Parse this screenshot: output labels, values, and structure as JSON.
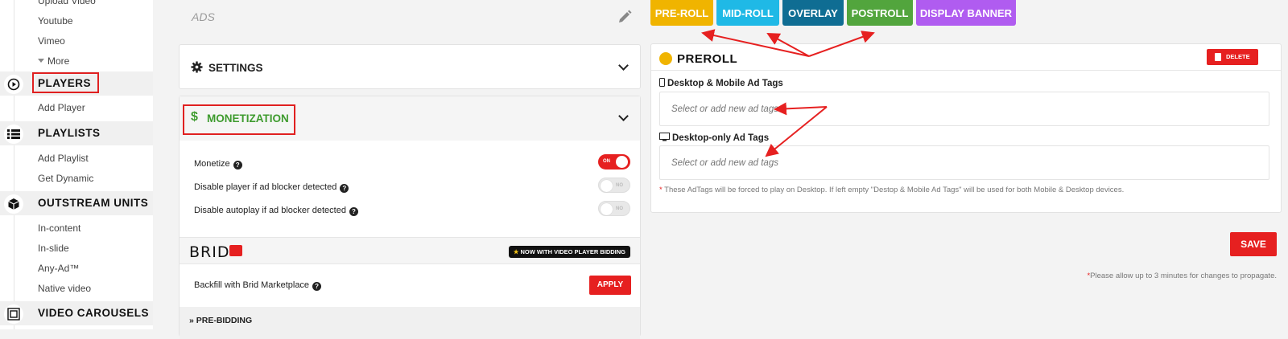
{
  "sidebar": {
    "videos_subitems": [
      "Upload Video",
      "Youtube",
      "Vimeo"
    ],
    "more_label": "More",
    "players": {
      "label": "PLAYERS",
      "subitems": [
        "Add Player"
      ]
    },
    "playlists": {
      "label": "PLAYLISTS",
      "subitems": [
        "Add Playlist",
        "Get Dynamic"
      ]
    },
    "outstream": {
      "label": "OUTSTREAM UNITS",
      "subitems": [
        "In-content",
        "In-slide",
        "Any-Ad™",
        "Native video"
      ]
    },
    "carousels": {
      "label": "VIDEO CAROUSELS"
    }
  },
  "ads": {
    "title": "ADS"
  },
  "settings": {
    "title": "SETTINGS"
  },
  "monetization": {
    "title": "MONETIZATION",
    "options": [
      {
        "label": "Monetize",
        "toggle": "ON",
        "state": true
      },
      {
        "label": "Disable player if ad blocker detected",
        "toggle": "NO",
        "state": false
      },
      {
        "label": "Disable autoplay if ad blocker detected",
        "toggle": "NO",
        "state": false
      }
    ],
    "brid_logo": "BRID",
    "bidding_badge": "NOW WITH VIDEO PLAYER BIDDING",
    "backfill_label": "Backfill with Brid Marketplace",
    "apply_label": "APPLY",
    "prebidding_label": "PRE-BIDDING"
  },
  "tabs": [
    {
      "label": "PRE-ROLL",
      "color": "#f0b400"
    },
    {
      "label": "MID-ROLL",
      "color": "#1fb9e6"
    },
    {
      "label": "OVERLAY",
      "color": "#0f6d93"
    },
    {
      "label": "POSTROLL",
      "color": "#52a53d"
    },
    {
      "label": "DISPLAY BANNER",
      "color": "#b05cf0"
    }
  ],
  "preroll": {
    "title": "PREROLL",
    "delete_label": "DELETE",
    "desktop_mobile_label": "Desktop & Mobile Ad Tags",
    "desktop_mobile_placeholder": "Select or add new ad tags",
    "desktop_only_label": "Desktop-only Ad Tags",
    "desktop_only_placeholder": "Select or add new ad tags",
    "note": "These AdTags will be forced to play on Desktop. If left empty \"Destop & Mobile Ad Tags\" will be used for both Mobile & Desktop devices."
  },
  "save_label": "SAVE",
  "propagate_note": "Please allow up to 3 minutes for changes to propagate.",
  "colors": {
    "accent_red": "#e62020",
    "monetization_green": "#3e9b2e",
    "preroll_dot": "#f0b400"
  }
}
